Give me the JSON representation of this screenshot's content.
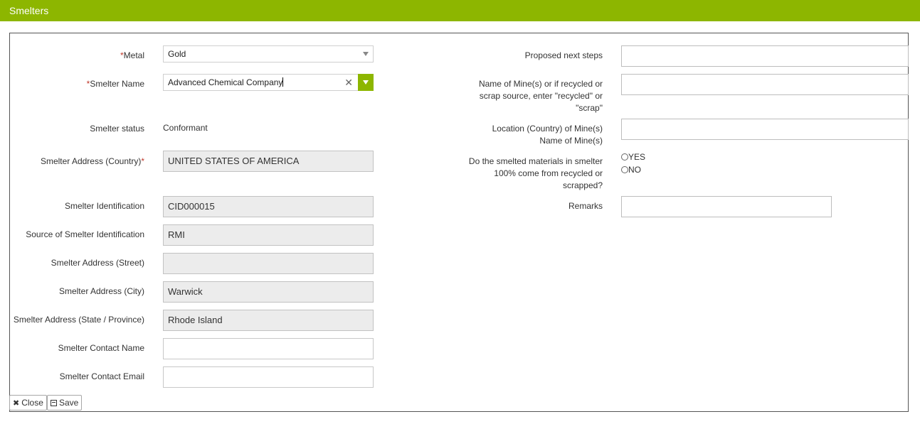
{
  "window": {
    "title": "Smelters"
  },
  "left": {
    "metal": {
      "required": "*",
      "label": "Metal",
      "value": "Gold"
    },
    "smelter_name": {
      "required": "*",
      "label": "Smelter Name",
      "value": "Advanced Chemical Company"
    },
    "smelter_status": {
      "label": "Smelter status",
      "value": "Conformant"
    },
    "address_country": {
      "label": "Smelter Address (Country)",
      "required": "*",
      "value": "UNITED STATES OF AMERICA"
    },
    "identification": {
      "label": "Smelter Identification",
      "value": "CID000015"
    },
    "id_source": {
      "label": "Source of Smelter Identification",
      "value": "RMI"
    },
    "address_street": {
      "label": "Smelter Address (Street)",
      "value": ""
    },
    "address_city": {
      "label": "Smelter Address (City)",
      "value": "Warwick"
    },
    "address_state": {
      "label": "Smelter Address (State / Province)",
      "value": "Rhode Island"
    },
    "contact_name": {
      "label": "Smelter Contact Name",
      "value": ""
    },
    "contact_email": {
      "label": "Smelter Contact Email",
      "value": ""
    }
  },
  "right": {
    "next_steps": {
      "label": "Proposed next steps",
      "value": ""
    },
    "mine_name": {
      "label_line1": "Name of Mine(s) or if recycled or",
      "label_line2": "scrap source, enter \"recycled\" or",
      "label_line3": "\"scrap\"",
      "value": ""
    },
    "mine_location": {
      "label_line1": "Location (Country) of Mine(s)",
      "label_line2": "Name of Mine(s)",
      "value": ""
    },
    "recycled": {
      "label_line1": "Do the smelted materials in smelter",
      "label_line2": "100% come from recycled or",
      "label_line3": "scrapped?",
      "option_yes": "YES",
      "option_no": "NO"
    },
    "remarks": {
      "label": "Remarks",
      "value": ""
    }
  },
  "buttons": {
    "close": "Close",
    "save": "Save"
  },
  "icons": {
    "close": "times-icon",
    "save": "floppy-disk-icon"
  },
  "colors": {
    "accent": "#8db600",
    "required": "#c0392b",
    "readonly_bg": "#ececec"
  }
}
